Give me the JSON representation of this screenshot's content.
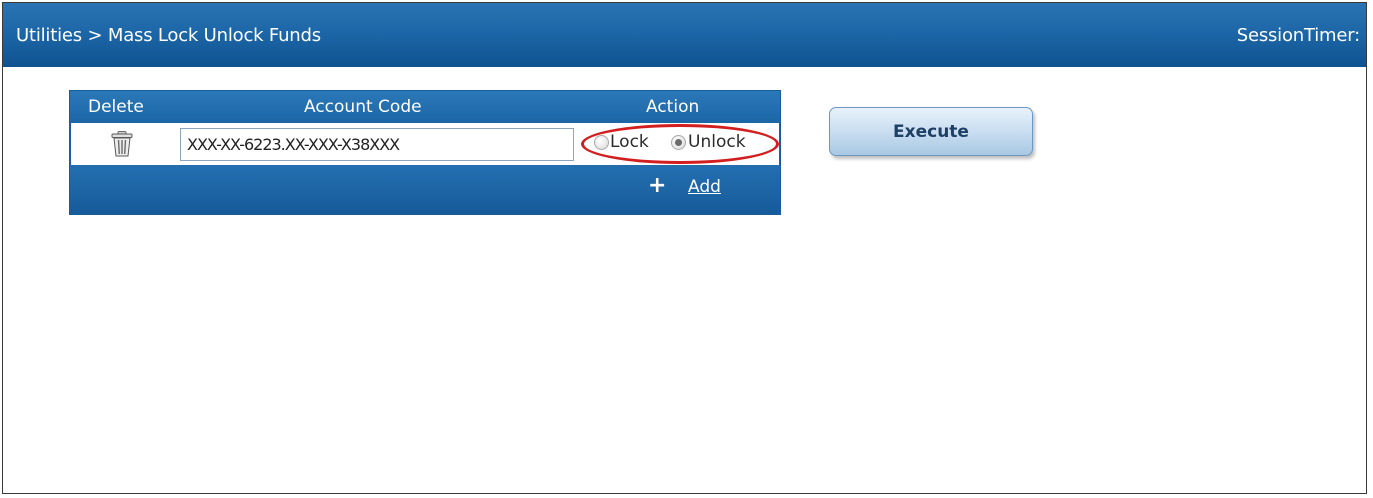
{
  "header": {
    "breadcrumb": "Utilities > Mass Lock Unlock Funds",
    "session_timer_label": "SessionTimer:"
  },
  "table": {
    "columns": [
      "Delete",
      "Account Code",
      "Action"
    ],
    "rows": [
      {
        "delete_icon": "trash-icon",
        "account_code": "XXX-XX-6223.XX-XXX-X38XXX",
        "action_options": [
          "Lock",
          "Unlock"
        ],
        "selected_action": "Unlock"
      }
    ],
    "add_label": "Add",
    "add_icon": "plus-icon"
  },
  "execute_label": "Execute",
  "colors": {
    "header_blue": "#1d67a8",
    "highlight_red": "#d21e1e",
    "button_light_blue": "#c9def0"
  }
}
